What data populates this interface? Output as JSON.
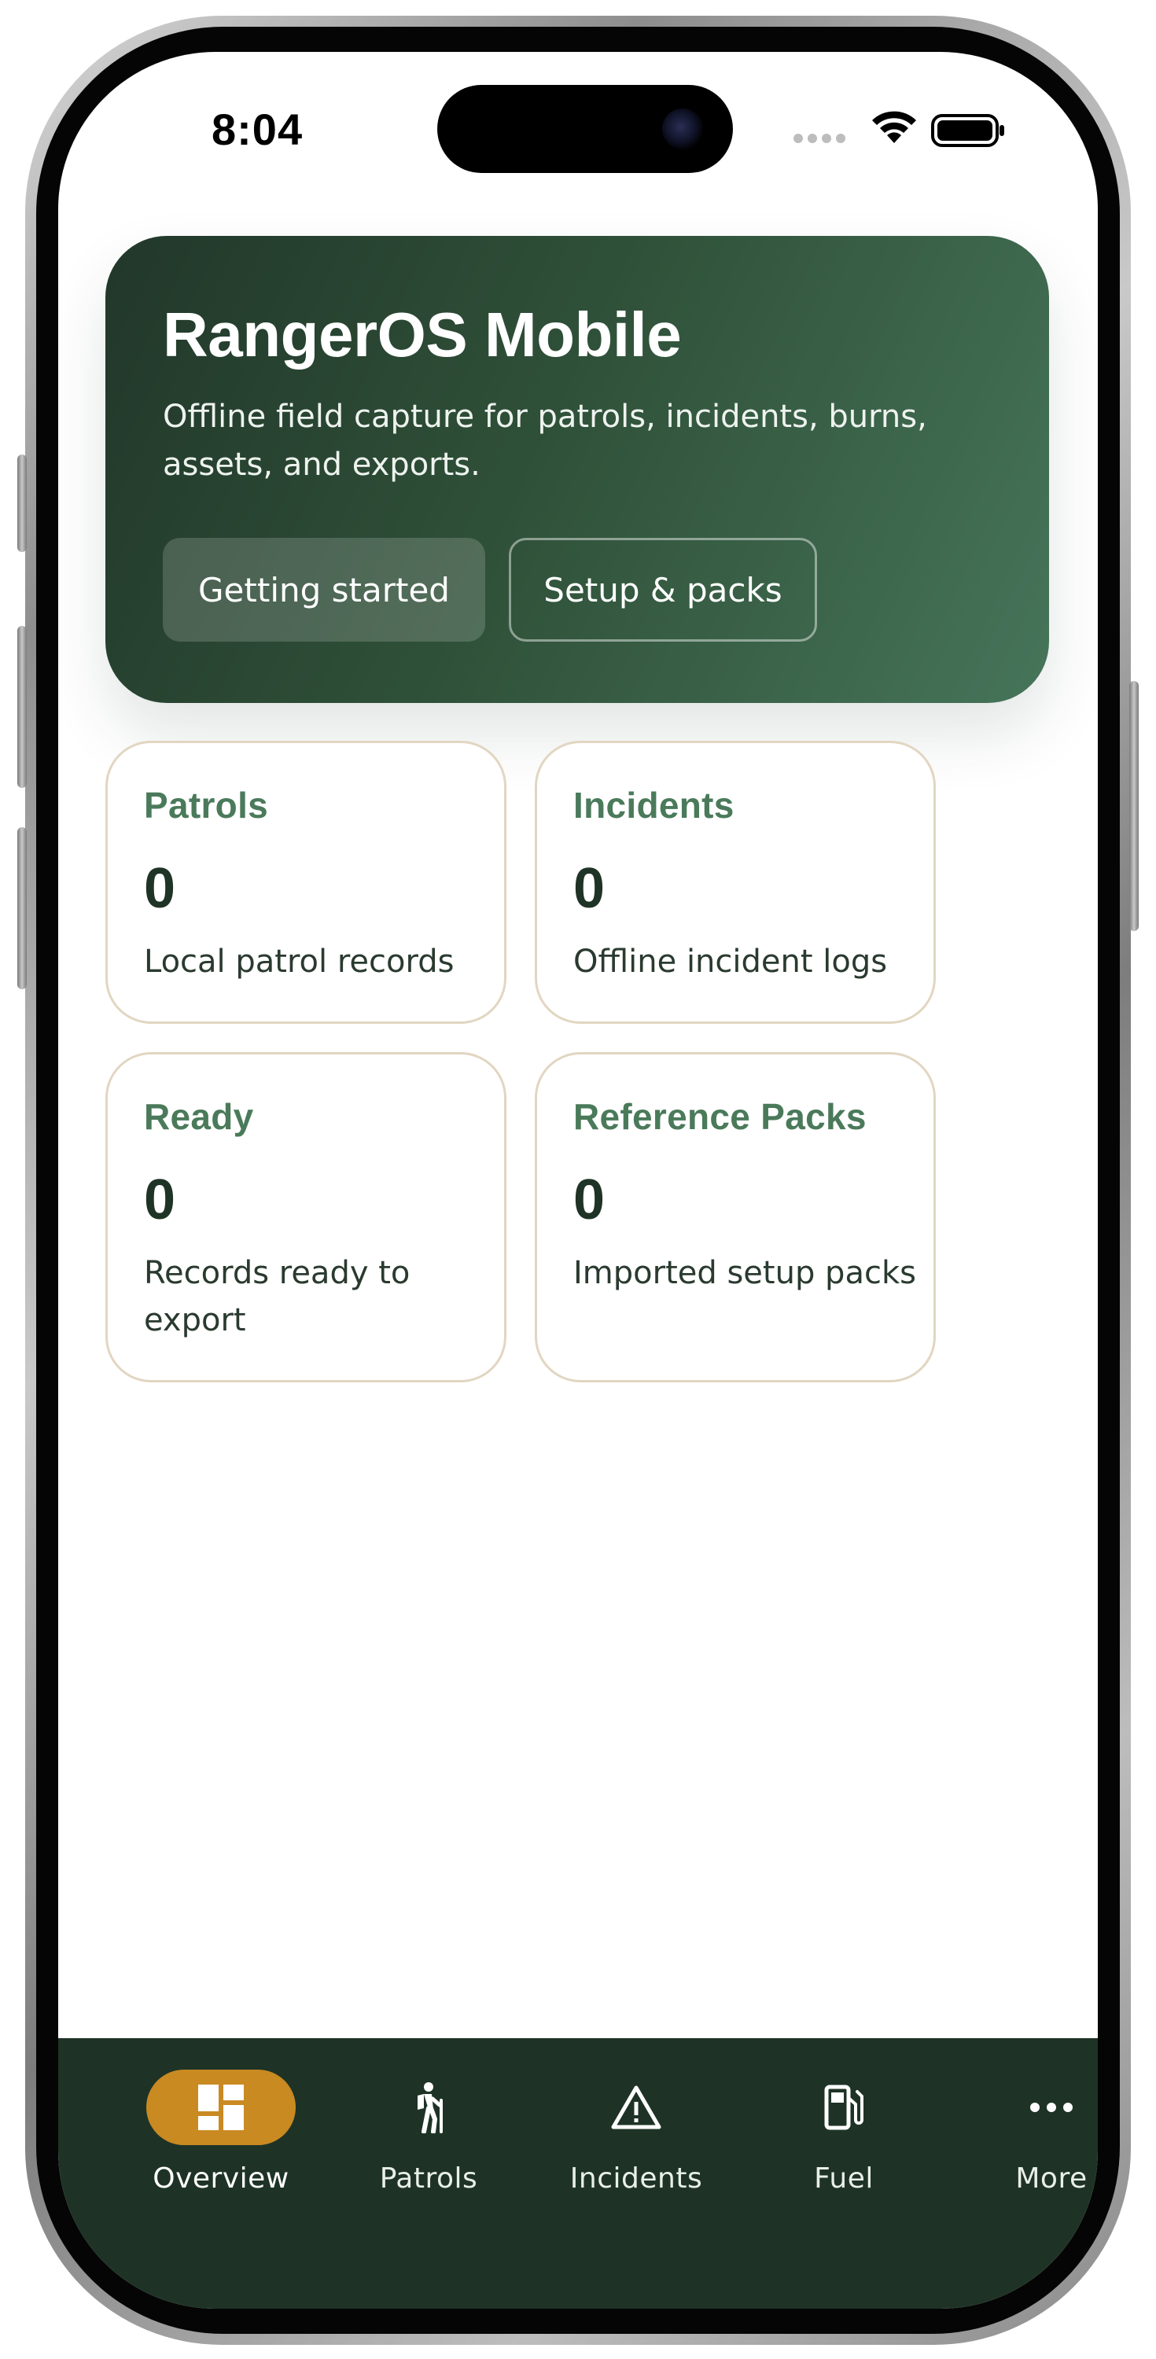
{
  "status_bar": {
    "time": "8:04"
  },
  "hero": {
    "title": "RangerOS Mobile",
    "subtitle": "Offline field capture for patrols, incidents, burns, assets, and exports.",
    "primary_button": "Getting started",
    "secondary_button": "Setup & packs"
  },
  "stats": [
    {
      "title": "Patrols",
      "value": "0",
      "description": "Local patrol records"
    },
    {
      "title": "Incidents",
      "value": "0",
      "description": "Offline incident logs"
    },
    {
      "title": "Ready",
      "value": "0",
      "description": "Records ready to export"
    },
    {
      "title": "Reference Packs",
      "value": "0",
      "description": "Imported setup packs"
    }
  ],
  "tabs": [
    {
      "label": "Overview",
      "icon": "dashboard-icon",
      "active": true
    },
    {
      "label": "Patrols",
      "icon": "hiker-icon",
      "active": false
    },
    {
      "label": "Incidents",
      "icon": "warning-icon",
      "active": false
    },
    {
      "label": "Fuel",
      "icon": "fuel-pump-icon",
      "active": false
    },
    {
      "label": "More",
      "icon": "more-icon",
      "active": false
    }
  ],
  "colors": {
    "hero_gradient_start": "#21372a",
    "hero_gradient_end": "#46755a",
    "stat_title": "#4a7a5a",
    "card_border": "#e2d6c2",
    "tab_bar": "#1e3326",
    "active_tab_pill": "#c98a22"
  }
}
